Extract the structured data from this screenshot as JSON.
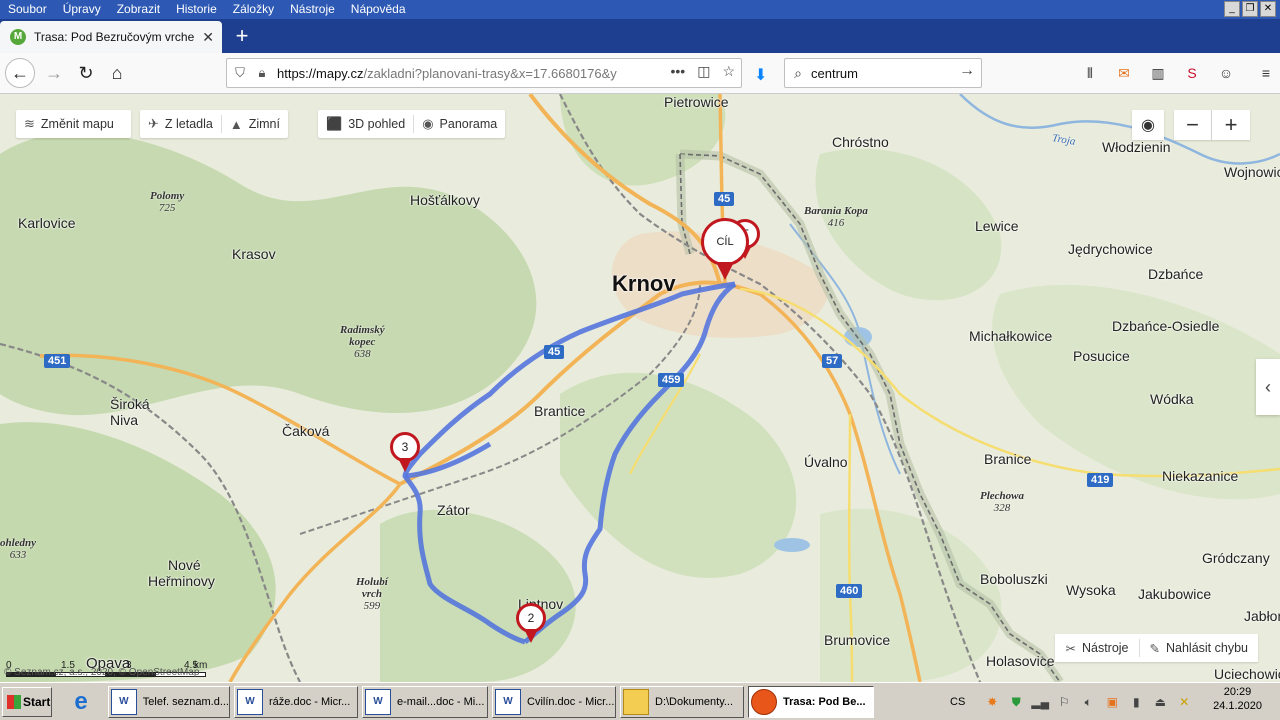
{
  "menu": [
    "Soubor",
    "Úpravy",
    "Zobrazit",
    "Historie",
    "Záložky",
    "Nástroje",
    "Nápověda"
  ],
  "window_controls": [
    "_",
    "❐",
    "✕"
  ],
  "tab": {
    "title": "Trasa: Pod Bezručovým vrchem",
    "favicon": "M"
  },
  "nav": {
    "url_domain": "https://mapy.cz",
    "url_path": "/zakladni?planovani-trasy&x=17.6680176&y",
    "search_value": "centrum"
  },
  "map": {
    "buttons": {
      "change_map": "Změnit mapu",
      "from_plane": "Z letadla",
      "winter": "Zimní",
      "view_3d": "3D pohled",
      "panorama": "Panorama"
    },
    "zoom": {
      "out": "−",
      "in": "+"
    },
    "places": [
      {
        "name": "Pietrowice",
        "key": "pietrowice"
      },
      {
        "name": "Chróstno",
        "key": "chrostno"
      },
      {
        "name": "Włodzienin",
        "key": "wlodzienin"
      },
      {
        "name": "Wojnowic",
        "key": "wojnowic"
      },
      {
        "name": "Karlovice",
        "key": "karlovice"
      },
      {
        "name": "Hošťálkovy",
        "key": "hostalkovy"
      },
      {
        "name": "Krasov",
        "key": "krasov"
      },
      {
        "name": "Lewice",
        "key": "lewice"
      },
      {
        "name": "Jędrychowice",
        "key": "jedrychowice"
      },
      {
        "name": "Dzbańce",
        "key": "dzbance"
      },
      {
        "name": "Krnov",
        "key": "krnov"
      },
      {
        "name": "Dzbańce-Osiedle",
        "key": "dzbance-osiedle"
      },
      {
        "name": "Michałkowice",
        "key": "michalkowice"
      },
      {
        "name": "Posucice",
        "key": "posucice"
      },
      {
        "name": "Široká",
        "key": "siroka"
      },
      {
        "name": "Niva",
        "key": "niva"
      },
      {
        "name": "Brantice",
        "key": "brantice"
      },
      {
        "name": "Wódka",
        "key": "wodka"
      },
      {
        "name": "Čaková",
        "key": "cakova"
      },
      {
        "name": "Úvalno",
        "key": "uvalno"
      },
      {
        "name": "Branice",
        "key": "branice"
      },
      {
        "name": "Niekazanice",
        "key": "niekazanice"
      },
      {
        "name": "Zátor",
        "key": "zator"
      },
      {
        "name": "Nové",
        "key": "nove"
      },
      {
        "name": "Heřminovy",
        "key": "herminovy"
      },
      {
        "name": "Gródczany",
        "key": "grodczany"
      },
      {
        "name": "Liptnov",
        "key": "liptnov"
      },
      {
        "name": "Boboluszki",
        "key": "boboluszki"
      },
      {
        "name": "Wysoka",
        "key": "wysoka"
      },
      {
        "name": "Jakubowice",
        "key": "jakubowice"
      },
      {
        "name": "Jabłon",
        "key": "jablon"
      },
      {
        "name": "Brumovice",
        "key": "brumovice"
      },
      {
        "name": "Holasovice",
        "key": "holasovice"
      },
      {
        "name": "Uciechowic",
        "key": "uciechowic"
      },
      {
        "name": "Opava",
        "key": "opava"
      }
    ],
    "peaks": [
      {
        "name": "Polomy",
        "elev": "725",
        "key": "polomy"
      },
      {
        "name": "Barania Kopa",
        "elev": "416",
        "key": "barania"
      },
      {
        "name": "Radimský",
        "name2": "kopec",
        "elev": "638",
        "key": "radimsky"
      },
      {
        "name": "Plechowa",
        "elev": "328",
        "key": "plechowa"
      },
      {
        "name": "Holubí",
        "name2": "vrch",
        "elev": "599",
        "key": "holubi"
      },
      {
        "name": "ohledny",
        "elev": "633",
        "key": "ohledny"
      }
    ],
    "river": "Troja",
    "roads": [
      {
        "num": "45",
        "key": "r45"
      },
      {
        "num": "57",
        "key": "r57"
      },
      {
        "num": "451",
        "key": "r451"
      },
      {
        "num": "419",
        "key": "r419"
      },
      {
        "num": "459",
        "key": "r459"
      },
      {
        "num": "460",
        "key": "r460"
      },
      {
        "num": "45",
        "key": "r45b"
      }
    ],
    "markers": {
      "finish": "CÍL",
      "start": "T",
      "m2": "2",
      "m3": "3"
    },
    "tools": {
      "tools": "Nástroje",
      "report": "Nahlásit chybu"
    },
    "scale": {
      "labels": [
        "0",
        "1.5",
        "3",
        "4.5"
      ],
      "unit": "km"
    },
    "copyright": "© Seznam.cz, a.s., 2020, © OpenStreetMap"
  },
  "taskbar": {
    "start": "Start",
    "tasks": [
      {
        "label": "Telef. seznam.d...",
        "icon": "W"
      },
      {
        "label": "ráže.doc - Micr...",
        "icon": "W"
      },
      {
        "label": "e-mail...doc - Mi...",
        "icon": "W"
      },
      {
        "label": "Cvilín.doc - Micr...",
        "icon": "W"
      },
      {
        "label": "D:\\Dokumenty...",
        "icon": "folder"
      },
      {
        "label": "Trasa: Pod Be...",
        "icon": "firefox"
      }
    ],
    "lang": "CS",
    "time": "20:29",
    "date": "24.1.2020"
  }
}
